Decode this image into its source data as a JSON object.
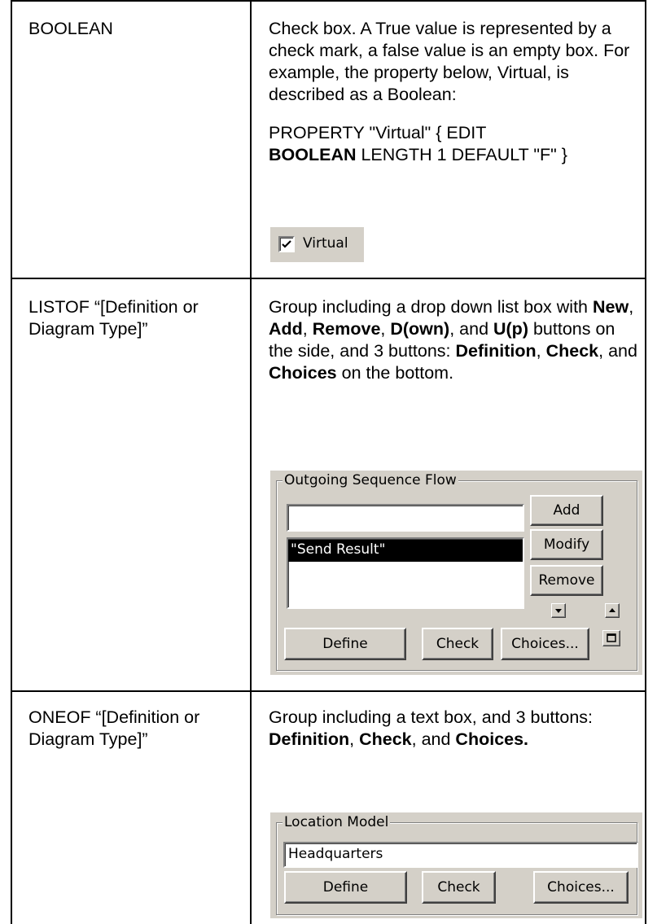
{
  "rows": [
    {
      "type_label": "BOOLEAN",
      "desc": "Check box. A True value is represented by a check mark, a false value is an empty box. For example, the property below, Virtual, is described as a Boolean:",
      "code_pre": "PROPERTY \"Virtual\" { EDIT",
      "code_bold": "BOOLEAN",
      "code_post": " LENGTH 1 DEFAULT \"F\" }",
      "checkbox": {
        "label": "Virtual",
        "checked": true
      }
    },
    {
      "type_label_1": "LISTOF “[Definition or",
      "type_label_2": "Diagram Type]”",
      "desc_parts": {
        "a": "Group including a drop down list box with ",
        "new": "New",
        "s1": ", ",
        "add": "Add",
        "s2": ", ",
        "remove": "Remove",
        "s3": ", ",
        "down": "D(own)",
        "s4": ", and ",
        "up": "U(p)",
        "b": " buttons on the side, and 3 buttons:  ",
        "definition": "Definition",
        "s5": ", ",
        "check": "Check",
        "s6": ", and ",
        "choices": "Choices",
        "c": " on the bottom."
      },
      "widget": {
        "group_title": "Outgoing Sequence Flow",
        "input_value": "",
        "list_items": [
          "\"Send Result\""
        ],
        "buttons": {
          "add": "Add",
          "modify": "Modify",
          "remove": "Remove",
          "define": "Define",
          "check": "Check",
          "choices": "Choices..."
        }
      }
    },
    {
      "type_label_1": "ONEOF “[Definition or",
      "type_label_2": "Diagram Type]”",
      "desc_parts": {
        "a": "Group including a text box, and 3 buttons:  ",
        "definition": "Definition",
        "s1": ", ",
        "check": "Check",
        "s2": ", and ",
        "choices": "Choices."
      },
      "widget": {
        "group_title": "Location Model",
        "input_value": "Headquarters",
        "buttons": {
          "define": "Define",
          "check": "Check",
          "choices": "Choices..."
        }
      }
    }
  ]
}
